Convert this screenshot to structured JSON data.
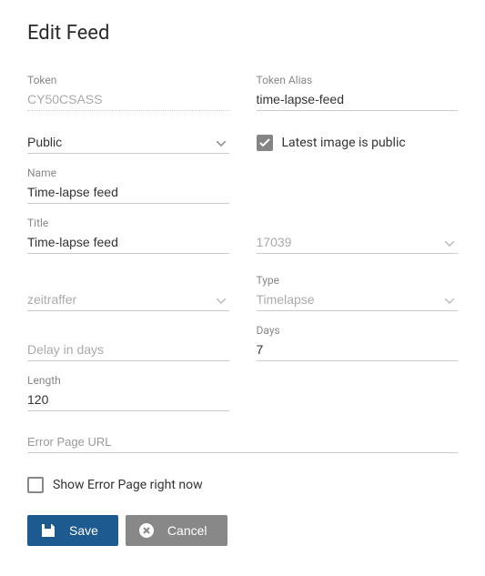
{
  "pageTitle": "Edit Feed",
  "token": {
    "label": "Token",
    "value": "CY50CSASS"
  },
  "tokenAlias": {
    "label": "Token Alias",
    "value": "time-lapse-feed"
  },
  "visibility": {
    "value": "Public"
  },
  "latestImagePublic": {
    "label": "Latest image is public",
    "checked": true
  },
  "name": {
    "label": "Name",
    "value": "Time-lapse feed"
  },
  "title": {
    "label": "Title",
    "value": "Time-lapse feed"
  },
  "idSelect": {
    "value": "17039"
  },
  "categorySelect": {
    "value": "zeitraffer"
  },
  "type": {
    "label": "Type",
    "value": "Timelapse"
  },
  "days": {
    "label": "Days",
    "value": "7"
  },
  "delay": {
    "label": "Delay in days",
    "value": ""
  },
  "length": {
    "label": "Length",
    "value": "120"
  },
  "errorUrl": {
    "placeholder": "Error Page URL",
    "value": ""
  },
  "showErrorNow": {
    "label": "Show Error Page right now",
    "checked": false
  },
  "buttons": {
    "save": "Save",
    "cancel": "Cancel"
  }
}
